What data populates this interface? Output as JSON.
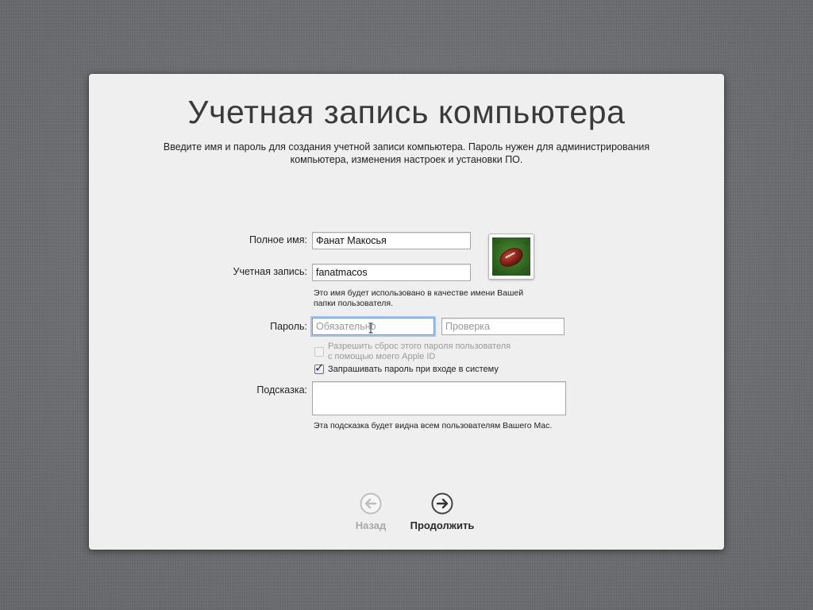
{
  "dialog": {
    "title": "Учетная запись компьютера",
    "description_line1": "Введите имя и пароль для создания учетной записи компьютера. Пароль нужен для администрирования",
    "description_line2": "компьютера, изменения настроек и установки ПО."
  },
  "form": {
    "full_name": {
      "label": "Полное имя:",
      "value": "Фанат Макосья"
    },
    "account": {
      "label": "Учетная запись:",
      "value": "fanatmacos",
      "note_line1": "Это имя будет использовано в качестве имени Вашей",
      "note_line2": "папки пользователя."
    },
    "password": {
      "label": "Пароль:",
      "placeholder": "Обязательно",
      "verify_placeholder": "Проверка"
    },
    "allow_reset": {
      "label_line1": "Разрешить сброс этого пароля пользователя",
      "label_line2": "с помощью моего Apple ID",
      "checked": false,
      "enabled": false
    },
    "require_password": {
      "label": "Запрашивать пароль при входе в систему",
      "checked": true
    },
    "hint": {
      "label": "Подсказка:",
      "value": "",
      "note": "Эта подсказка будет видна всем пользователям Вашего Mac."
    },
    "avatar_icon": "football-icon"
  },
  "navigation": {
    "back_label": "Назад",
    "back_enabled": false,
    "continue_label": "Продолжить",
    "continue_enabled": true
  },
  "colors": {
    "background": "#6b6d71",
    "panel": "#efefef",
    "focus_ring": "#6d9ed3",
    "checkmark": "#1c2c7a"
  }
}
